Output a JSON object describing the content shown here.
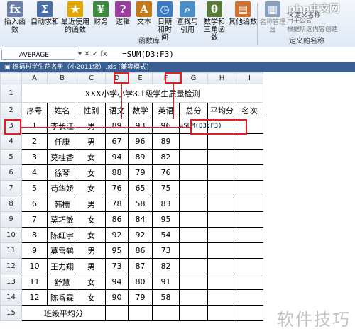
{
  "ribbon": {
    "buttons": [
      {
        "icon": "fx-icon",
        "label": "插入函数",
        "glyph": "fx",
        "color": "#6b7fa8"
      },
      {
        "icon": "sum-icon",
        "label": "自动求和",
        "glyph": "Σ",
        "color": "#4a6fa8"
      },
      {
        "icon": "star-icon",
        "label": "最近使用的函数",
        "glyph": "★",
        "color": "#e2a800"
      },
      {
        "icon": "finance-icon",
        "label": "财务",
        "glyph": "¥",
        "color": "#3c8a3c"
      },
      {
        "icon": "logic-icon",
        "label": "逻辑",
        "glyph": "?",
        "color": "#9a3fa0"
      },
      {
        "icon": "text-icon",
        "label": "文本",
        "glyph": "A",
        "color": "#c07a1a"
      },
      {
        "icon": "clock-icon",
        "label": "日期和时间",
        "glyph": "◷",
        "color": "#3b7bc0"
      },
      {
        "icon": "lookup-icon",
        "label": "查找与引用",
        "glyph": "⌕",
        "color": "#4a8fc8"
      },
      {
        "icon": "math-icon",
        "label": "数学和三角函数",
        "glyph": "θ",
        "color": "#5a7a3a"
      },
      {
        "icon": "more-icon",
        "label": "其他函数",
        "glyph": "▤",
        "color": "#d07030"
      }
    ],
    "group_label_lib": "函数库",
    "group_label_names": "定义的名称",
    "name_manager": "名称管理器",
    "define_name": "定义名称",
    "use_in_formula": "用于公式",
    "from_selection": "根据所选内容创建"
  },
  "brand": "php中文网",
  "formula_bar": {
    "name_box": "AVERAGE",
    "fx_symbols": "▾  ✕ ✓ fx",
    "formula": "=SUM(D3:F3)"
  },
  "doc_title": "祝福村学生花名册（小2011级）.xls [兼容模式]",
  "columns": [
    "A",
    "B",
    "C",
    "D",
    "E",
    "F",
    "G",
    "H",
    "I"
  ],
  "sheet_title": "XXX小学小学3.1级学生质量检测",
  "headers": [
    "序号",
    "姓名",
    "性别",
    "语文",
    "数学",
    "英语",
    "总分",
    "平均分",
    "名次"
  ],
  "rows": [
    [
      "1",
      "李长江",
      "男",
      "89",
      "93",
      "96",
      "=SUM(D3:F3)",
      "",
      ""
    ],
    [
      "2",
      "任康",
      "男",
      "67",
      "96",
      "89",
      "",
      "",
      ""
    ],
    [
      "3",
      "莫桂香",
      "女",
      "94",
      "89",
      "82",
      "",
      "",
      ""
    ],
    [
      "4",
      "徐琴",
      "女",
      "88",
      "79",
      "76",
      "",
      "",
      ""
    ],
    [
      "5",
      "苟华娇",
      "女",
      "76",
      "65",
      "75",
      "",
      "",
      ""
    ],
    [
      "6",
      "韩栅",
      "男",
      "78",
      "58",
      "83",
      "",
      "",
      ""
    ],
    [
      "7",
      "莫巧敏",
      "女",
      "86",
      "84",
      "95",
      "",
      "",
      ""
    ],
    [
      "8",
      "陈红宇",
      "女",
      "92",
      "92",
      "54",
      "",
      "",
      ""
    ],
    [
      "9",
      "莫雪鹤",
      "男",
      "95",
      "86",
      "73",
      "",
      "",
      ""
    ],
    [
      "10",
      "王力翔",
      "男",
      "73",
      "87",
      "82",
      "",
      "",
      ""
    ],
    [
      "11",
      "舒慧",
      "女",
      "94",
      "80",
      "91",
      "",
      "",
      ""
    ],
    [
      "12",
      "陈香霖",
      "女",
      "90",
      "79",
      "58",
      "",
      "",
      ""
    ]
  ],
  "footer_label": "班级平均分",
  "row_numbers": [
    "1",
    "2",
    "3",
    "4",
    "5",
    "6",
    "7",
    "8",
    "9",
    "10",
    "11",
    "12",
    "13",
    "14",
    "15"
  ],
  "watermark": "软件技巧"
}
